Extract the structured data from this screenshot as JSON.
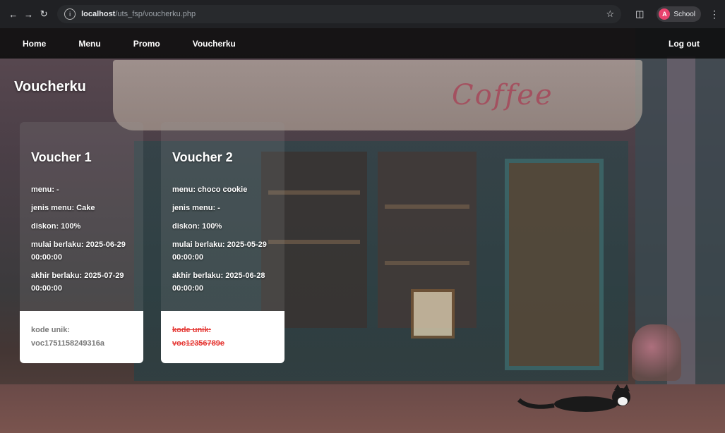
{
  "browser": {
    "url_host": "localhost",
    "url_path": "/uts_fsp/voucherku.php",
    "profile_label": "School",
    "profile_initial": "A"
  },
  "nav": {
    "items": [
      "Home",
      "Menu",
      "Promo",
      "Voucherku"
    ],
    "logout": "Log out"
  },
  "page": {
    "title": "Voucherku"
  },
  "vouchers": [
    {
      "title": "Voucher 1",
      "menu": "menu: -",
      "jenis_menu": "jenis menu: Cake",
      "diskon": "diskon: 100%",
      "mulai": "mulai berlaku: 2025-06-29 00:00:00",
      "akhir": "akhir berlaku: 2025-07-29 00:00:00",
      "code_label": "kode unik:",
      "code_value": "voc1751158249316a",
      "used": false
    },
    {
      "title": "Voucher 2",
      "menu": "menu: choco cookie",
      "jenis_menu": "jenis menu: -",
      "diskon": "diskon: 100%",
      "mulai": "mulai berlaku: 2025-05-29 00:00:00",
      "akhir": "akhir berlaku: 2025-06-28 00:00:00",
      "code_label": "kode unik:",
      "code_value": "voc12356789e",
      "used": true
    }
  ],
  "scene": {
    "shop_sign": "Coffee"
  }
}
